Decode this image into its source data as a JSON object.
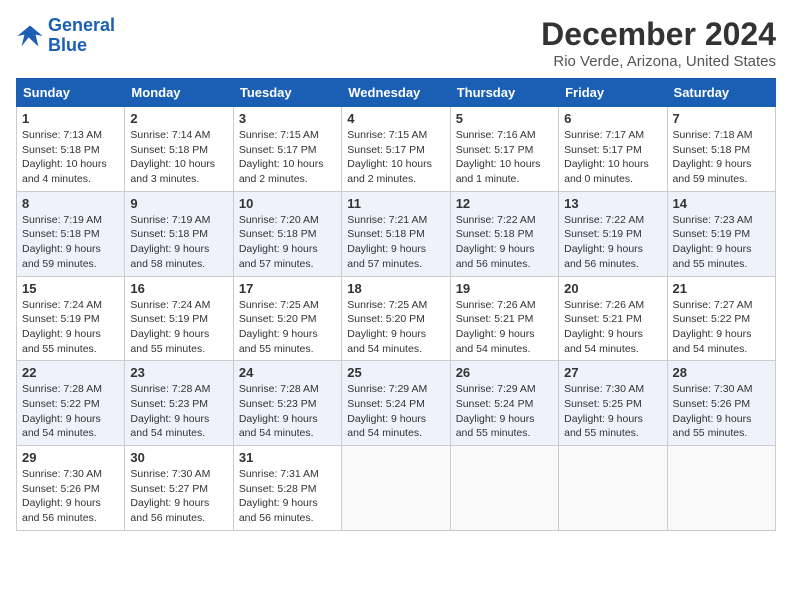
{
  "logo": {
    "line1": "General",
    "line2": "Blue"
  },
  "title": "December 2024",
  "subtitle": "Rio Verde, Arizona, United States",
  "headers": [
    "Sunday",
    "Monday",
    "Tuesday",
    "Wednesday",
    "Thursday",
    "Friday",
    "Saturday"
  ],
  "weeks": [
    [
      {
        "day": "1",
        "info": "Sunrise: 7:13 AM\nSunset: 5:18 PM\nDaylight: 10 hours\nand 4 minutes."
      },
      {
        "day": "2",
        "info": "Sunrise: 7:14 AM\nSunset: 5:18 PM\nDaylight: 10 hours\nand 3 minutes."
      },
      {
        "day": "3",
        "info": "Sunrise: 7:15 AM\nSunset: 5:17 PM\nDaylight: 10 hours\nand 2 minutes."
      },
      {
        "day": "4",
        "info": "Sunrise: 7:15 AM\nSunset: 5:17 PM\nDaylight: 10 hours\nand 2 minutes."
      },
      {
        "day": "5",
        "info": "Sunrise: 7:16 AM\nSunset: 5:17 PM\nDaylight: 10 hours\nand 1 minute."
      },
      {
        "day": "6",
        "info": "Sunrise: 7:17 AM\nSunset: 5:17 PM\nDaylight: 10 hours\nand 0 minutes."
      },
      {
        "day": "7",
        "info": "Sunrise: 7:18 AM\nSunset: 5:18 PM\nDaylight: 9 hours\nand 59 minutes."
      }
    ],
    [
      {
        "day": "8",
        "info": "Sunrise: 7:19 AM\nSunset: 5:18 PM\nDaylight: 9 hours\nand 59 minutes."
      },
      {
        "day": "9",
        "info": "Sunrise: 7:19 AM\nSunset: 5:18 PM\nDaylight: 9 hours\nand 58 minutes."
      },
      {
        "day": "10",
        "info": "Sunrise: 7:20 AM\nSunset: 5:18 PM\nDaylight: 9 hours\nand 57 minutes."
      },
      {
        "day": "11",
        "info": "Sunrise: 7:21 AM\nSunset: 5:18 PM\nDaylight: 9 hours\nand 57 minutes."
      },
      {
        "day": "12",
        "info": "Sunrise: 7:22 AM\nSunset: 5:18 PM\nDaylight: 9 hours\nand 56 minutes."
      },
      {
        "day": "13",
        "info": "Sunrise: 7:22 AM\nSunset: 5:19 PM\nDaylight: 9 hours\nand 56 minutes."
      },
      {
        "day": "14",
        "info": "Sunrise: 7:23 AM\nSunset: 5:19 PM\nDaylight: 9 hours\nand 55 minutes."
      }
    ],
    [
      {
        "day": "15",
        "info": "Sunrise: 7:24 AM\nSunset: 5:19 PM\nDaylight: 9 hours\nand 55 minutes."
      },
      {
        "day": "16",
        "info": "Sunrise: 7:24 AM\nSunset: 5:19 PM\nDaylight: 9 hours\nand 55 minutes."
      },
      {
        "day": "17",
        "info": "Sunrise: 7:25 AM\nSunset: 5:20 PM\nDaylight: 9 hours\nand 55 minutes."
      },
      {
        "day": "18",
        "info": "Sunrise: 7:25 AM\nSunset: 5:20 PM\nDaylight: 9 hours\nand 54 minutes."
      },
      {
        "day": "19",
        "info": "Sunrise: 7:26 AM\nSunset: 5:21 PM\nDaylight: 9 hours\nand 54 minutes."
      },
      {
        "day": "20",
        "info": "Sunrise: 7:26 AM\nSunset: 5:21 PM\nDaylight: 9 hours\nand 54 minutes."
      },
      {
        "day": "21",
        "info": "Sunrise: 7:27 AM\nSunset: 5:22 PM\nDaylight: 9 hours\nand 54 minutes."
      }
    ],
    [
      {
        "day": "22",
        "info": "Sunrise: 7:28 AM\nSunset: 5:22 PM\nDaylight: 9 hours\nand 54 minutes."
      },
      {
        "day": "23",
        "info": "Sunrise: 7:28 AM\nSunset: 5:23 PM\nDaylight: 9 hours\nand 54 minutes."
      },
      {
        "day": "24",
        "info": "Sunrise: 7:28 AM\nSunset: 5:23 PM\nDaylight: 9 hours\nand 54 minutes."
      },
      {
        "day": "25",
        "info": "Sunrise: 7:29 AM\nSunset: 5:24 PM\nDaylight: 9 hours\nand 54 minutes."
      },
      {
        "day": "26",
        "info": "Sunrise: 7:29 AM\nSunset: 5:24 PM\nDaylight: 9 hours\nand 55 minutes."
      },
      {
        "day": "27",
        "info": "Sunrise: 7:30 AM\nSunset: 5:25 PM\nDaylight: 9 hours\nand 55 minutes."
      },
      {
        "day": "28",
        "info": "Sunrise: 7:30 AM\nSunset: 5:26 PM\nDaylight: 9 hours\nand 55 minutes."
      }
    ],
    [
      {
        "day": "29",
        "info": "Sunrise: 7:30 AM\nSunset: 5:26 PM\nDaylight: 9 hours\nand 56 minutes."
      },
      {
        "day": "30",
        "info": "Sunrise: 7:30 AM\nSunset: 5:27 PM\nDaylight: 9 hours\nand 56 minutes."
      },
      {
        "day": "31",
        "info": "Sunrise: 7:31 AM\nSunset: 5:28 PM\nDaylight: 9 hours\nand 56 minutes."
      },
      {
        "day": "",
        "info": ""
      },
      {
        "day": "",
        "info": ""
      },
      {
        "day": "",
        "info": ""
      },
      {
        "day": "",
        "info": ""
      }
    ]
  ]
}
